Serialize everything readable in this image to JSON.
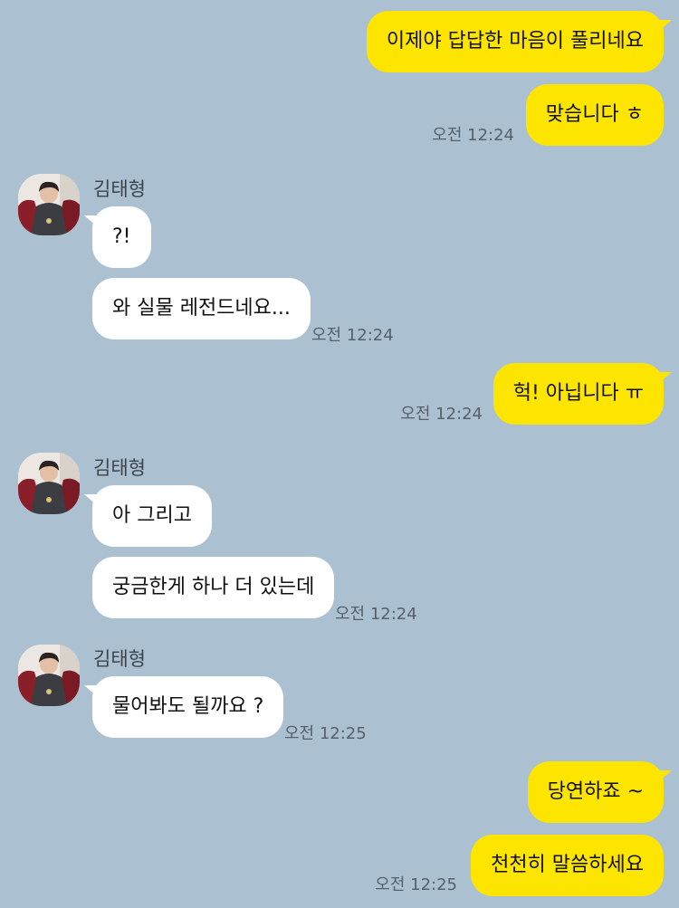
{
  "colors": {
    "background": "#abc1d1",
    "my_bubble": "#fee500",
    "their_bubble": "#ffffff",
    "timestamp": "#55606b"
  },
  "contact": {
    "name": "김태형",
    "avatar_icon": "profile-photo-icon"
  },
  "messages": {
    "m1": {
      "sender": "me",
      "text": "이제야 답답한 마음이 풀리네요"
    },
    "m2": {
      "sender": "me",
      "text": "맞습니다 ㅎ",
      "time": "오전 12:24"
    },
    "g1": {
      "sender_name": "김태형"
    },
    "m3": {
      "sender": "them",
      "text": "?!"
    },
    "m4": {
      "sender": "them",
      "text": "와 실물 레전드네요...",
      "time": "오전 12:24"
    },
    "m5": {
      "sender": "me",
      "text": "헉! 아닙니다 ㅠ",
      "time": "오전 12:24"
    },
    "g2": {
      "sender_name": "김태형"
    },
    "m6": {
      "sender": "them",
      "text": "아 그리고"
    },
    "m7": {
      "sender": "them",
      "text": "궁금한게 하나 더 있는데",
      "time": "오전 12:24"
    },
    "g3": {
      "sender_name": "김태형"
    },
    "m8": {
      "sender": "them",
      "text": "물어봐도 될까요 ?",
      "time": "오전 12:25"
    },
    "m9": {
      "sender": "me",
      "text": "당연하죠 ~"
    },
    "m10": {
      "sender": "me",
      "text": "천천히 말씀하세요",
      "time": "오전 12:25"
    }
  }
}
